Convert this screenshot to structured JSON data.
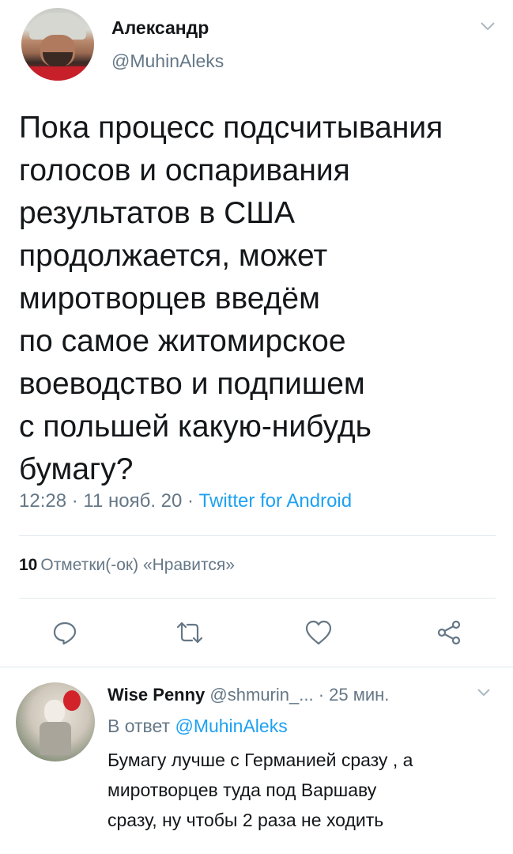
{
  "tweet": {
    "author_name": "Александр",
    "author_handle": "@MuhinAleks",
    "text": "Пока процесс подсчитывания\nголосов и оспаривания\nрезультатов в США\nпродолжается, может\nмиротворцев введём\nпо самое житомирское\nвоеводство и подпишем\nс польшей какую-нибудь\nбумагу?",
    "time": "12:28 · 11 нояб. 20 · ",
    "source": "Twitter for Android",
    "likes_count": "10",
    "likes_label": "Отметки(-ок) «Нравится»"
  },
  "actions": [
    "reply-icon",
    "retweet-icon",
    "like-icon",
    "share-icon"
  ],
  "reply": {
    "author_name": "Wise Penny",
    "author_handle": "@shmurin_...",
    "time": " · 25 мин.",
    "reply_to_prefix": "В ответ ",
    "reply_to_handle": "@MuhinAleks",
    "text": "Бумагу лучше с Германией сразу , а\nмиротворцев туда под Варшаву\nсразу, ну чтобы 2 раза не ходить"
  },
  "colors": {
    "text": "#14171a",
    "secondary": "#657786",
    "accent": "#1da1f2",
    "divider": "#e1e8ed"
  }
}
